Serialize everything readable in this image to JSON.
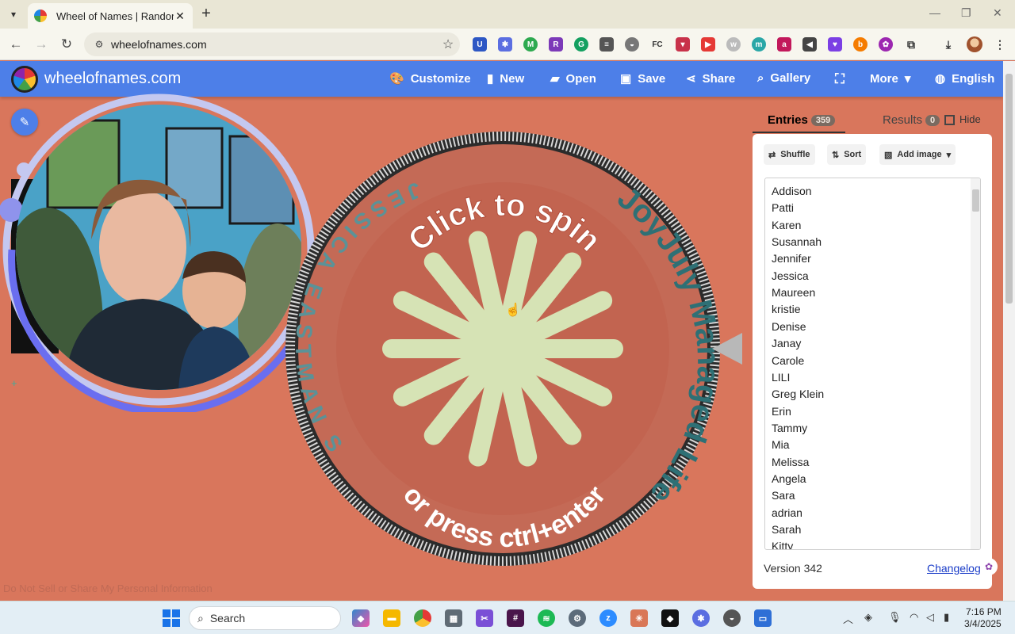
{
  "browser": {
    "tab_title": "Wheel of Names | Random nam",
    "url": "wheelofnames.com",
    "icons": [
      "chevron-down-icon",
      "close-icon",
      "plus-icon",
      "back-icon",
      "forward-icon",
      "reload-icon",
      "site-info-icon",
      "star-icon",
      "download-icon",
      "extensions-icon",
      "menu-dots-icon"
    ]
  },
  "site": {
    "name": "wheelofnames.com",
    "menu": {
      "customize": "Customize",
      "new": "New",
      "open": "Open",
      "save": "Save",
      "share": "Share",
      "gallery": "Gallery",
      "more": "More",
      "language": "English"
    },
    "accent": "#4d7fe8",
    "background": "#d9765c"
  },
  "wheel": {
    "prompt_top": "Click to spin",
    "prompt_bottom": "or press ctrl+enter",
    "text_top": "JESSICA EASTMAN STEWART",
    "text_right": "JoyJuly Managed Life"
  },
  "panel": {
    "entries_label": "Entries",
    "entries_count": "359",
    "results_label": "Results",
    "results_count": "0",
    "hide_label": "Hide",
    "shuffle": "Shuffle",
    "sort": "Sort",
    "add_image": "Add image",
    "entries": [
      "Addison",
      "Patti",
      "Karen",
      "Susannah",
      "Jennifer",
      "Jessica",
      "Maureen",
      "kristie",
      "Denise",
      "Janay",
      "Carole",
      "LILI",
      "Greg Klein",
      "Erin",
      "Tammy",
      "Mia",
      "Melissa",
      "Angela",
      "Sara",
      "adrian",
      "Sarah",
      "Kitty"
    ],
    "version": "Version 342",
    "changelog": "Changelog"
  },
  "footer": {
    "do_not_sell": "Do Not Sell or Share My Personal Information"
  },
  "taskbar": {
    "search_placeholder": "Search",
    "time": "7:16 PM",
    "date": "3/4/2025"
  }
}
